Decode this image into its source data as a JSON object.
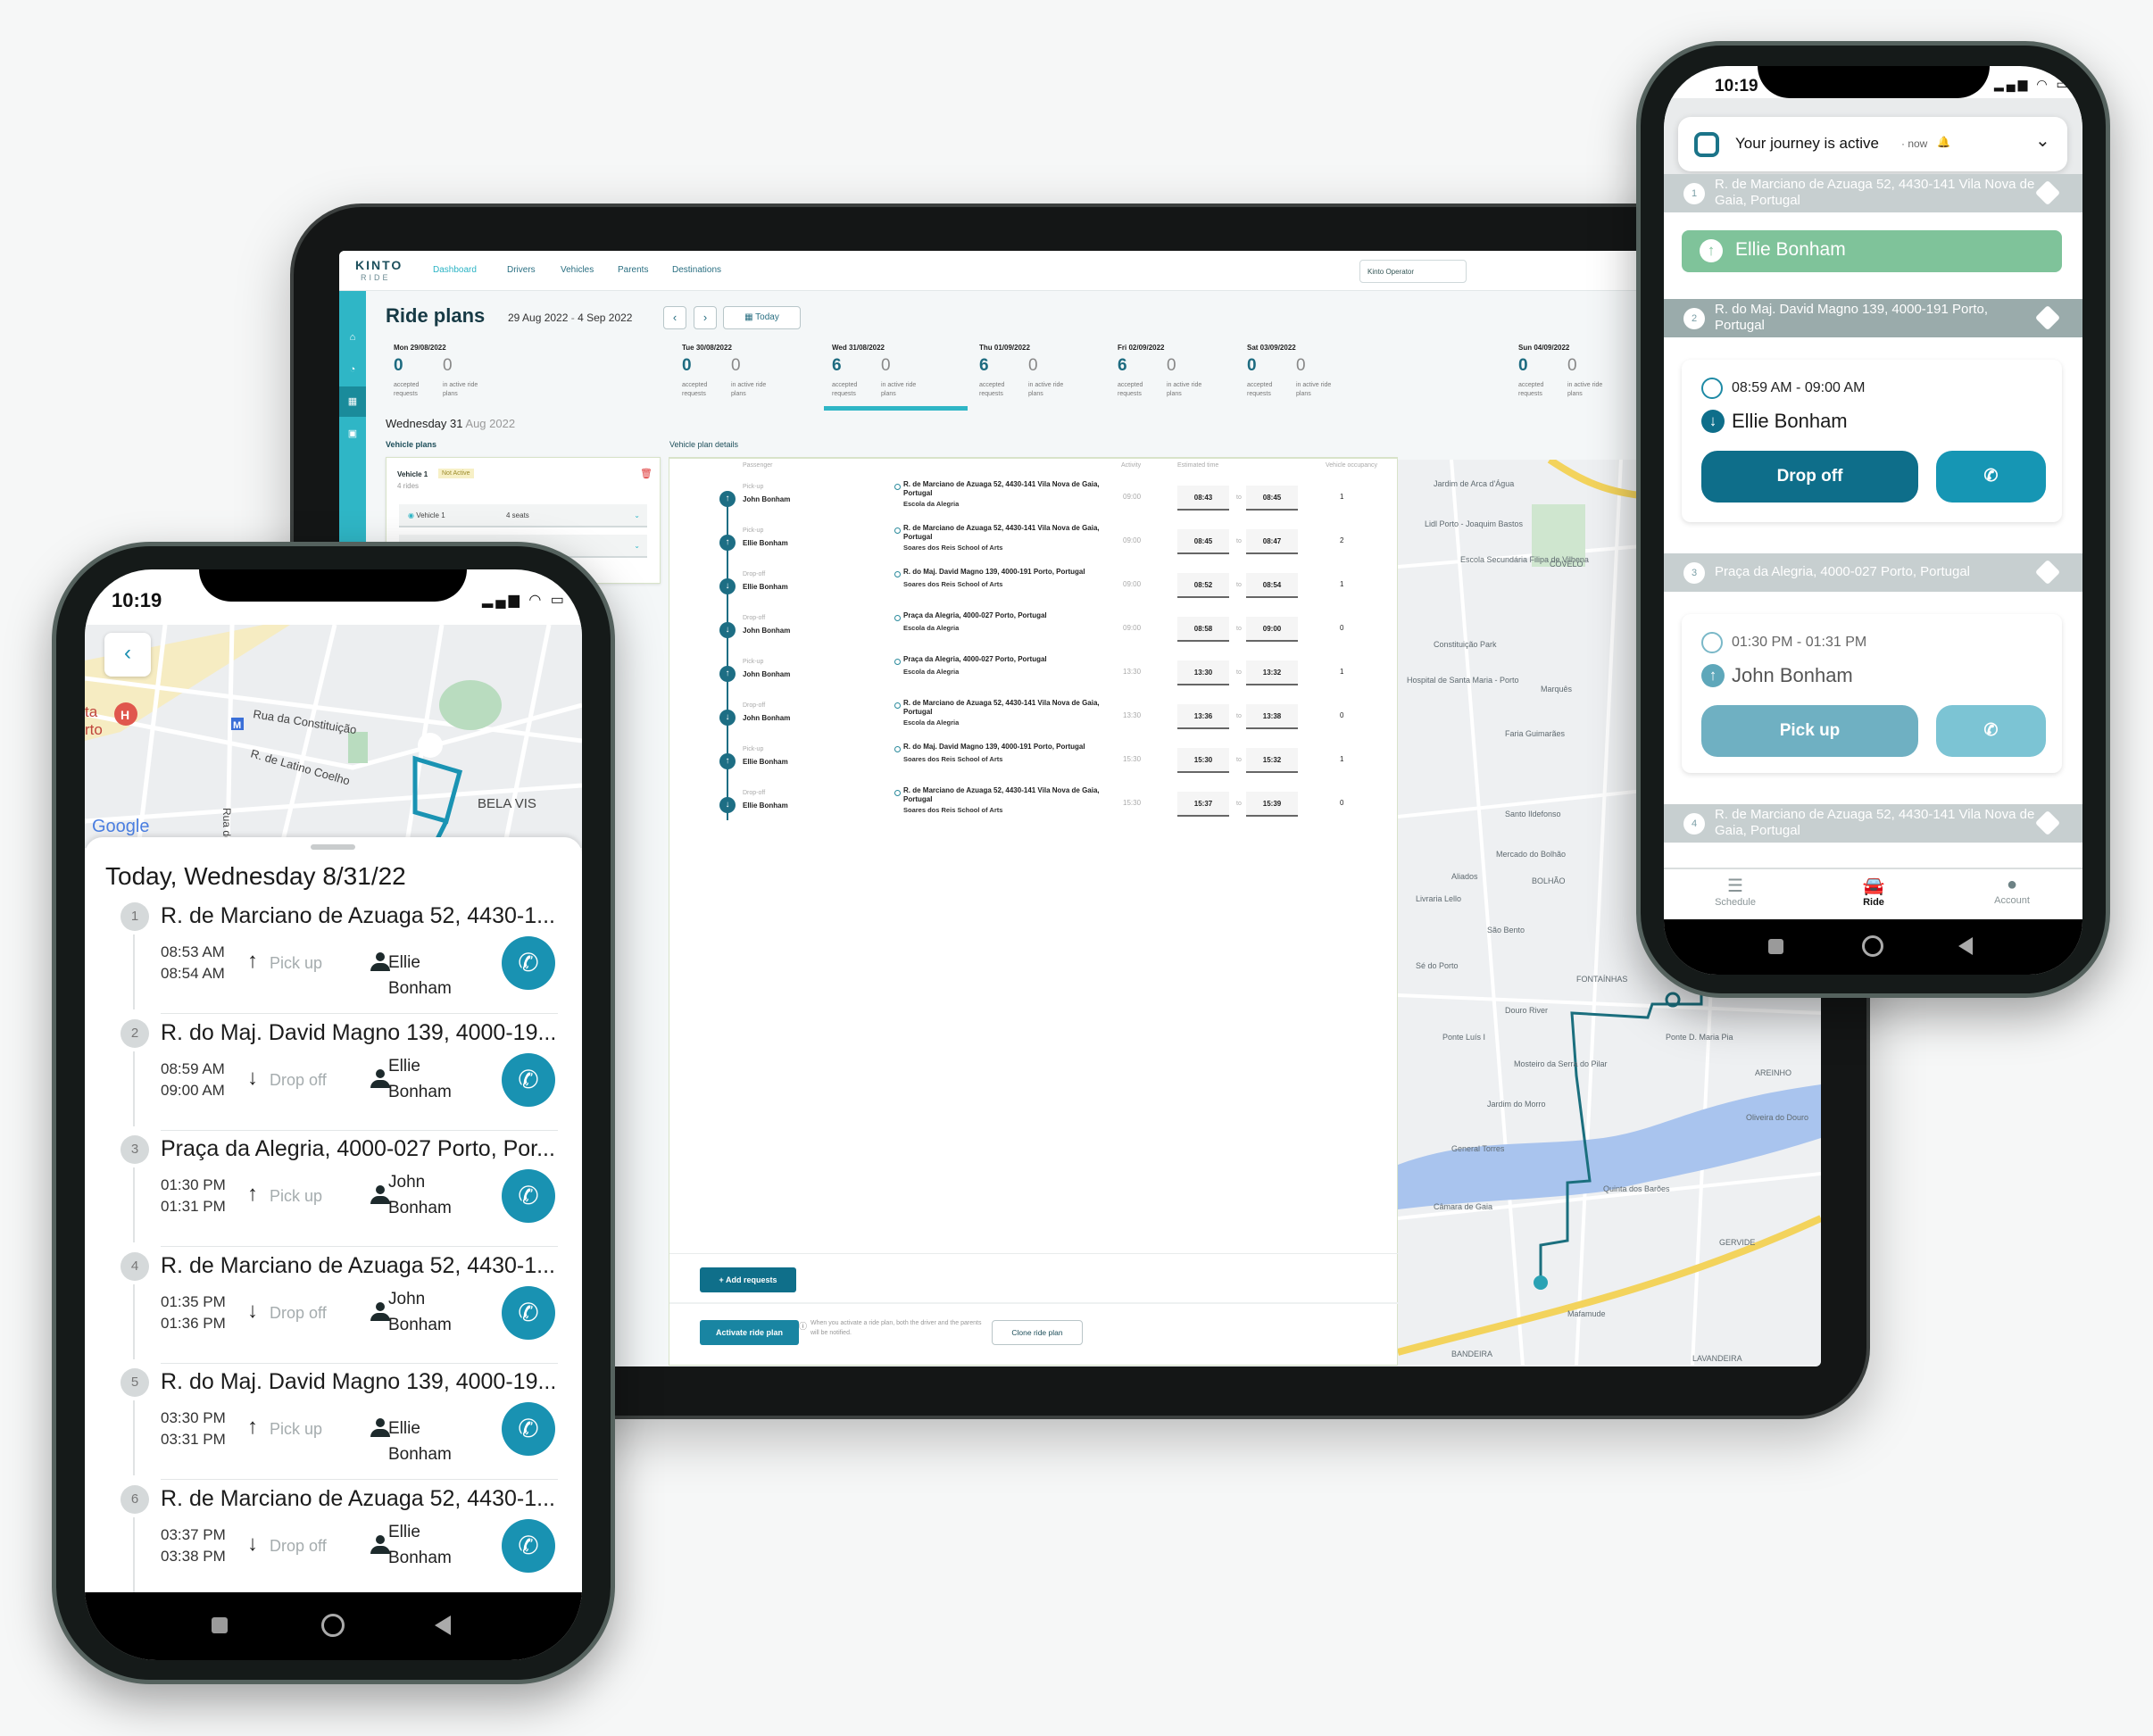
{
  "tablet": {
    "logo": {
      "line1": "KINTO",
      "line2": "RIDE"
    },
    "nav": [
      "Dashboard",
      "Drivers",
      "Vehicles",
      "Parents",
      "Destinations"
    ],
    "active_nav": "Dashboard",
    "operator_button": "Kinto Operator",
    "sidebar_icons": [
      "car-icon",
      "bell-icon",
      "calendar-icon",
      "checklist-icon"
    ],
    "page_title": "Ride plans",
    "date_range": {
      "start": "29 Aug 2022",
      "sep": " - ",
      "end": "4 Sep 2022"
    },
    "prev_icon": "‹",
    "next_icon": "›",
    "today_button": "Today",
    "days": [
      {
        "label": "Mon  29/08/2022",
        "accepted": "0",
        "active": "0"
      },
      {
        "label": "Tue  30/08/2022",
        "accepted": "0",
        "active": "0"
      },
      {
        "label": "Wed  31/08/2022",
        "accepted": "6",
        "active": "0"
      },
      {
        "label": "Thu  01/09/2022",
        "accepted": "6",
        "active": "0"
      },
      {
        "label": "Fri  02/09/2022",
        "accepted": "6",
        "active": "0"
      },
      {
        "label": "Sat  03/09/2022",
        "accepted": "0",
        "active": "0"
      },
      {
        "label": "Sun  04/09/2022",
        "accepted": "0",
        "active": "0"
      }
    ],
    "accepted_label": "accepted requests",
    "active_label": "in active ride plans",
    "selected_day": "Wed  31/08/2022",
    "selected_heading": {
      "day": "Wednesday 31",
      "rest": " Aug 2022"
    },
    "vehicle_plans_label": "Vehicle plans",
    "vehicle_card": {
      "name": "Vehicle 1",
      "status": "Not Active",
      "rides": "4 rides",
      "vehicle_select": "Vehicle 1",
      "seats": "4 seats"
    },
    "details_label": "Vehicle plan details",
    "columns": [
      "Passenger",
      "Activity",
      "Estimated time",
      "Vehicle occupancy"
    ],
    "to_label": "to",
    "rows": [
      {
        "type": "Pick-up",
        "passenger": "John Bonham",
        "address": "R. de Marciano de Azuaga 52, 4430-141 Vila Nova de Gaia, Portugal",
        "destination": "Escola da Alegria",
        "activity": "09:00",
        "from": "08:43",
        "to": "08:45",
        "occupancy": "1"
      },
      {
        "type": "Pick-up",
        "passenger": "Ellie Bonham",
        "address": "R. de Marciano de Azuaga 52, 4430-141 Vila Nova de Gaia, Portugal",
        "destination": "Soares dos Reis School of Arts",
        "activity": "09:00",
        "from": "08:45",
        "to": "08:47",
        "occupancy": "2"
      },
      {
        "type": "Drop-off",
        "passenger": "Ellie Bonham",
        "address": "R. do Maj. David Magno 139, 4000-191 Porto, Portugal",
        "destination": "Soares dos Reis School of Arts",
        "activity": "09:00",
        "from": "08:52",
        "to": "08:54",
        "occupancy": "1"
      },
      {
        "type": "Drop-off",
        "passenger": "John Bonham",
        "address": "Praça da Alegria, 4000-027 Porto, Portugal",
        "destination": "Escola da Alegria",
        "activity": "09:00",
        "from": "08:58",
        "to": "09:00",
        "occupancy": "0"
      },
      {
        "type": "Pick-up",
        "passenger": "John Bonham",
        "address": "Praça da Alegria, 4000-027 Porto, Portugal",
        "destination": "Escola da Alegria",
        "activity": "13:30",
        "from": "13:30",
        "to": "13:32",
        "occupancy": "1"
      },
      {
        "type": "Drop-off",
        "passenger": "John Bonham",
        "address": "R. de Marciano de Azuaga 52, 4430-141 Vila Nova de Gaia, Portugal",
        "destination": "Escola da Alegria",
        "activity": "13:30",
        "from": "13:36",
        "to": "13:38",
        "occupancy": "0"
      },
      {
        "type": "Pick-up",
        "passenger": "Ellie Bonham",
        "address": "R. do Maj. David Magno 139, 4000-191 Porto, Portugal",
        "destination": "Soares dos Reis School of Arts",
        "activity": "15:30",
        "from": "15:30",
        "to": "15:32",
        "occupancy": "1"
      },
      {
        "type": "Drop-off",
        "passenger": "Ellie Bonham",
        "address": "R. de Marciano de Azuaga 52, 4430-141 Vila Nova de Gaia, Portugal",
        "destination": "Soares dos Reis School of Arts",
        "activity": "15:30",
        "from": "15:37",
        "to": "15:39",
        "occupancy": "0"
      }
    ],
    "add_requests": "+  Add requests",
    "activate_button": "Activate ride plan",
    "info_text": "When you activate a ride plan, both the driver and the parents will be notified.",
    "clone_button": "Clone ride plan",
    "map_labels": [
      "Jardim de Arca d'Água",
      "Lidl Porto - Joaquim Bastos",
      "Escola Secundária Filipa de Vilhena",
      "COVELO",
      "Constituição Park",
      "Hospital de Santa Maria - Porto",
      "Marquês",
      "Faria Guimarães",
      "Santo Ildefonso",
      "Mercado do Bolhão",
      "BOLHÃO",
      "Aliados",
      "Livraria Lello",
      "São Bento",
      "Sé do Porto",
      "FONTAÍNHAS",
      "Douro River",
      "Ponte Luís I",
      "Ponte D. Maria Pia",
      "Mosteiro da Serra do Pilar",
      "Jardim do Morro",
      "AREINHO",
      "Oliveira do Douro",
      "General Torres",
      "Câmara de Gaia",
      "Quinta dos Barões",
      "GERVIDE",
      "Mafamude",
      "BANDEIRA",
      "LAVANDEIRA"
    ],
    "route_color": "#1b6f7e"
  },
  "left_phone": {
    "status_time": "10:19",
    "map_labels": {
      "street1": "Rua da Constituição",
      "street2": "R. de Latino Coelho",
      "street3": "Rua de",
      "area": "BELA VIS",
      "poi": "ta\nrto",
      "metro": "M",
      "hospital": "H",
      "google": "Google"
    },
    "title": "Today, Wednesday 8/31/22",
    "stops": [
      {
        "num": "1",
        "address": "R. de Marciano de Azuaga 52, 4430-1...",
        "start": "08:53 AM",
        "end": "08:54 AM",
        "action": "Pick up",
        "direction": "up",
        "name": "Ellie Bonham"
      },
      {
        "num": "2",
        "address": "R. do Maj. David Magno 139, 4000-19...",
        "start": "08:59 AM",
        "end": "09:00 AM",
        "action": "Drop off",
        "direction": "down",
        "name": "Ellie Bonham"
      },
      {
        "num": "3",
        "address": "Praça da Alegria, 4000-027 Porto, Por...",
        "start": "01:30 PM",
        "end": "01:31 PM",
        "action": "Pick up",
        "direction": "up",
        "name": "John Bonham"
      },
      {
        "num": "4",
        "address": "R. de Marciano de Azuaga 52, 4430-1...",
        "start": "01:35 PM",
        "end": "01:36 PM",
        "action": "Drop off",
        "direction": "down",
        "name": "John Bonham"
      },
      {
        "num": "5",
        "address": "R. do Maj. David Magno 139, 4000-19...",
        "start": "03:30 PM",
        "end": "03:31 PM",
        "action": "Pick up",
        "direction": "up",
        "name": "Ellie Bonham"
      },
      {
        "num": "6",
        "address": "R. de Marciano de Azuaga 52, 4430-1...",
        "start": "03:37 PM",
        "end": "03:38 PM",
        "action": "Drop off",
        "direction": "down",
        "name": "Ellie Bonham"
      }
    ],
    "call_color": "#1992b2"
  },
  "right_phone": {
    "status_time": "10:19",
    "notification": {
      "title": "Your journey is active",
      "time": "· now"
    },
    "stops": [
      {
        "num": "1",
        "address": "R. de Marciano de Azuaga 52, 4430-141 Vila Nova de Gaia, Portugal"
      },
      {
        "num": "2",
        "address": "R. do Maj. David Magno 139, 4000-191 Porto, Portugal"
      },
      {
        "num": "3",
        "address": "Praça da Alegria, 4000-027 Porto, Portugal"
      },
      {
        "num": "4",
        "address": "R. de Marciano de Azuaga 52, 4430-141 Vila Nova de Gaia, Portugal"
      }
    ],
    "completed_pickup": "Ellie Bonham",
    "current": {
      "time": "08:59 AM - 09:00 AM",
      "name": "Ellie Bonham",
      "action": "Drop off"
    },
    "next": {
      "time": "01:30 PM - 01:31 PM",
      "name": "John Bonham",
      "action": "Pick up"
    },
    "tabs": [
      "Schedule",
      "Ride",
      "Account"
    ],
    "active_tab": "Ride",
    "colors": {
      "primary": "#0e6e8a",
      "call": "#1696b4",
      "completed": "#7fc39a",
      "stop_bar": "#c7cfd0",
      "active_stop_bar": "#9aabab"
    }
  }
}
